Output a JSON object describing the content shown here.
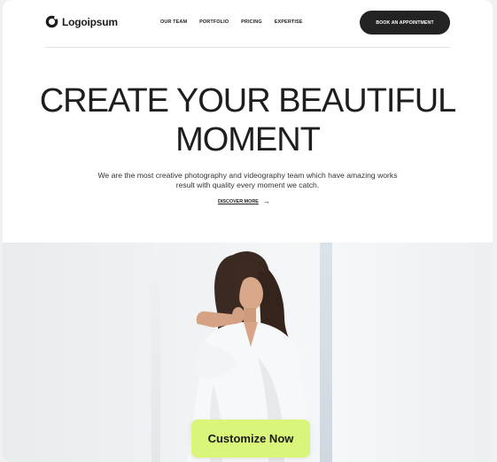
{
  "header": {
    "logo_text": "Logoipsum",
    "logo_icon": "logo-ring-icon",
    "nav": [
      "OUR TEAM",
      "PORTFOLIO",
      "PRICING",
      "EXPERTISE"
    ],
    "cta_label": "BOOK AN APPOINTMENT"
  },
  "hero": {
    "headline_line1": "CREATE YOUR BEAUTIFUL",
    "headline_line2": "MOMENT",
    "subtext": "We are the most creative photography and videography team which have amazing works result with quality every moment we catch.",
    "discover_label": "DISCOVER MORE",
    "discover_icon": "arrow-right-icon"
  },
  "photo": {
    "customize_label": "Customize Now"
  },
  "colors": {
    "cta_bg": "#232323",
    "customize_bg": "#d9f57a",
    "text": "#1e1e1e"
  }
}
